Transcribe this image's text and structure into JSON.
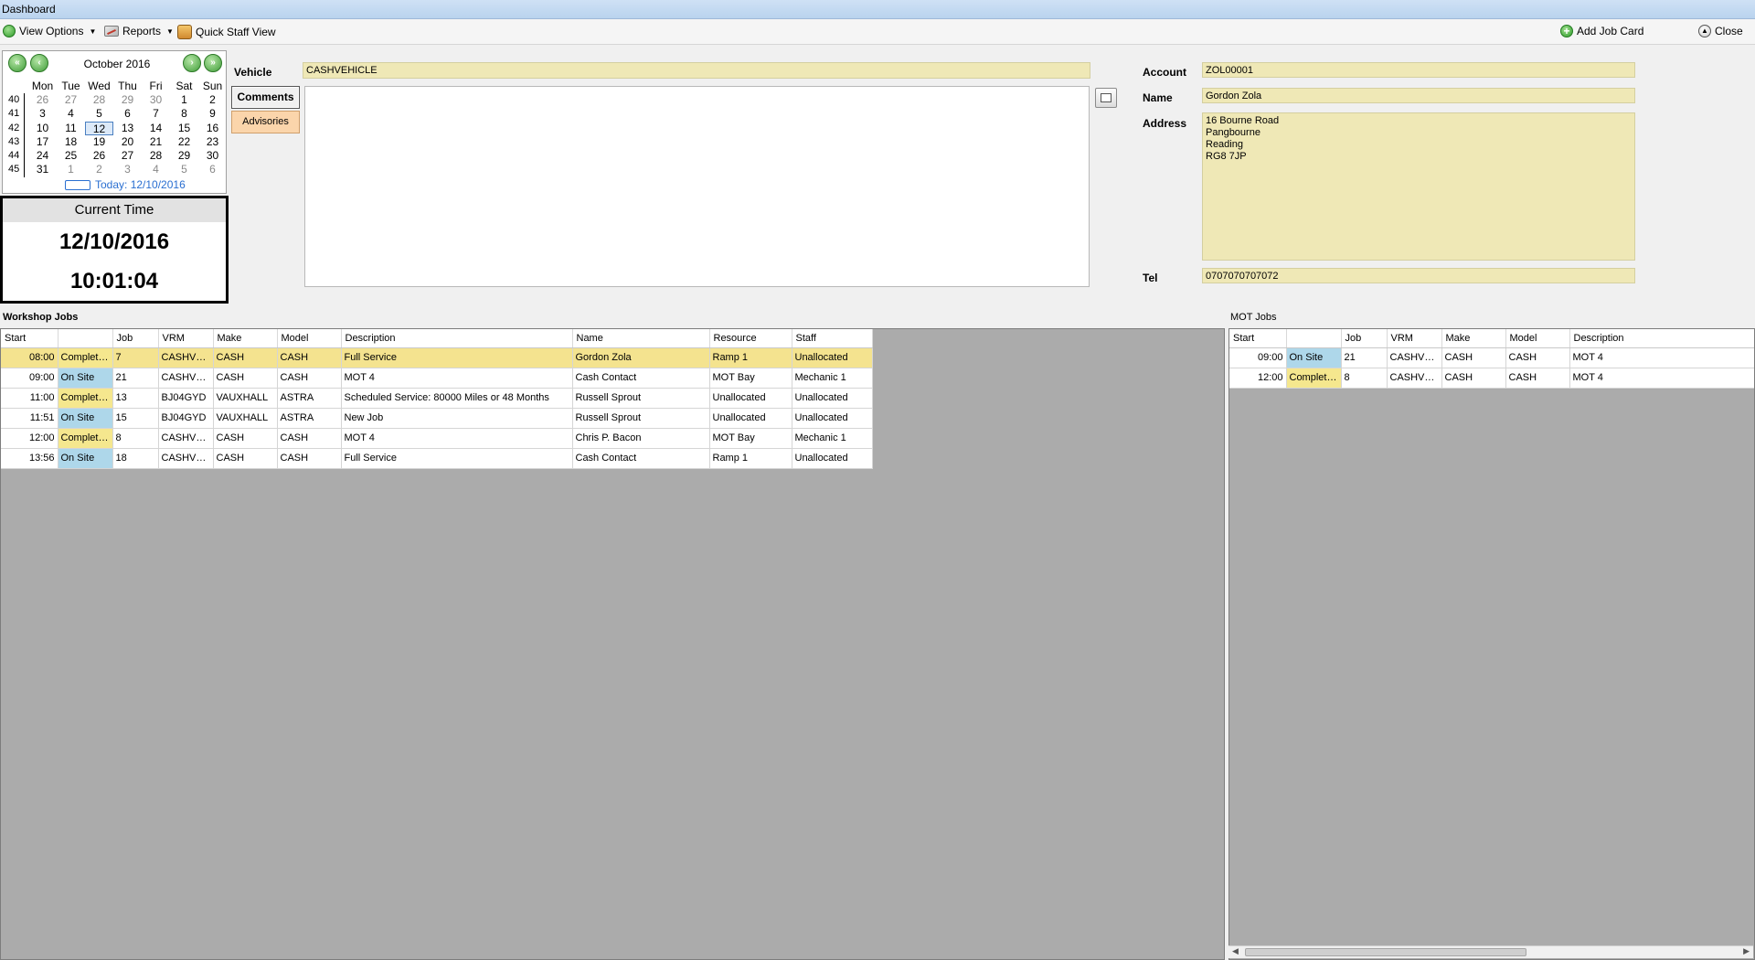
{
  "window": {
    "title": "Dashboard"
  },
  "toolbar": {
    "view_options": "View Options",
    "reports": "Reports",
    "quick_staff_view": "Quick Staff View",
    "add_job_card": "Add Job Card",
    "close": "Close"
  },
  "calendar": {
    "month_label": "October 2016",
    "day_headers": [
      "Mon",
      "Tue",
      "Wed",
      "Thu",
      "Fri",
      "Sat",
      "Sun"
    ],
    "week_numbers": [
      "40",
      "41",
      "42",
      "43",
      "44",
      "45"
    ],
    "days": [
      [
        "26",
        "27",
        "28",
        "29",
        "30",
        "1",
        "2"
      ],
      [
        "3",
        "4",
        "5",
        "6",
        "7",
        "8",
        "9"
      ],
      [
        "10",
        "11",
        "12",
        "13",
        "14",
        "15",
        "16"
      ],
      [
        "17",
        "18",
        "19",
        "20",
        "21",
        "22",
        "23"
      ],
      [
        "24",
        "25",
        "26",
        "27",
        "28",
        "29",
        "30"
      ],
      [
        "31",
        "1",
        "2",
        "3",
        "4",
        "5",
        "6"
      ]
    ],
    "selected_day": "12",
    "today_label": "Today: 12/10/2016"
  },
  "current_time": {
    "header": "Current Time",
    "date": "12/10/2016",
    "time": "10:01:04"
  },
  "job_detail": {
    "vehicle_label": "Vehicle",
    "vehicle_value": "CASHVEHICLE",
    "comments_tab": "Comments",
    "advisories_tab": "Advisories",
    "account_label": "Account",
    "account_value": "ZOL00001",
    "name_label": "Name",
    "name_value": "Gordon Zola",
    "address_label": "Address",
    "address_value": "16 Bourne Road\nPangbourne\nReading\nRG8 7JP",
    "tel_label": "Tel",
    "tel_value": "0707070707072"
  },
  "workshop_jobs": {
    "title": "Workshop Jobs",
    "columns": [
      "Start",
      "",
      "Job",
      "VRM",
      "Make",
      "Model",
      "Description",
      "Name",
      "Resource",
      "Staff"
    ],
    "rows": [
      {
        "start": "08:00",
        "status": "Completed",
        "job": "7",
        "vrm": "CASHVE...",
        "make": "CASH",
        "model": "CASH",
        "description": "Full Service",
        "name": "Gordon Zola",
        "resource": "Ramp 1",
        "staff": "Unallocated"
      },
      {
        "start": "09:00",
        "status": "On Site",
        "job": "21",
        "vrm": "CASHVE...",
        "make": "CASH",
        "model": "CASH",
        "description": "MOT 4",
        "name": "Cash Contact",
        "resource": "MOT Bay",
        "staff": "Mechanic 1"
      },
      {
        "start": "11:00",
        "status": "Completed",
        "job": "13",
        "vrm": "BJ04GYD",
        "make": "VAUXHALL",
        "model": "ASTRA",
        "description": "Scheduled Service: 80000 Miles or 48 Months",
        "name": "Russell Sprout",
        "resource": "Unallocated",
        "staff": "Unallocated"
      },
      {
        "start": "11:51",
        "status": "On Site",
        "job": "15",
        "vrm": "BJ04GYD",
        "make": "VAUXHALL",
        "model": "ASTRA",
        "description": "New Job",
        "name": "Russell Sprout",
        "resource": "Unallocated",
        "staff": "Unallocated"
      },
      {
        "start": "12:00",
        "status": "Completed",
        "job": "8",
        "vrm": "CASHVE...",
        "make": "CASH",
        "model": "CASH",
        "description": "MOT 4",
        "name": "Chris P. Bacon",
        "resource": "MOT Bay",
        "staff": "Mechanic 1"
      },
      {
        "start": "13:56",
        "status": "On Site",
        "job": "18",
        "vrm": "CASHVE...",
        "make": "CASH",
        "model": "CASH",
        "description": "Full Service",
        "name": "Cash Contact",
        "resource": "Ramp 1",
        "staff": "Unallocated"
      }
    ]
  },
  "mot_jobs": {
    "title": "MOT Jobs",
    "columns": [
      "Start",
      "",
      "Job",
      "VRM",
      "Make",
      "Model",
      "Description"
    ],
    "rows": [
      {
        "start": "09:00",
        "status": "On Site",
        "job": "21",
        "vrm": "CASHVE...",
        "make": "CASH",
        "model": "CASH",
        "description": "MOT 4"
      },
      {
        "start": "12:00",
        "status": "Completed",
        "job": "8",
        "vrm": "CASHVE...",
        "make": "CASH",
        "model": "CASH",
        "description": "MOT 4"
      }
    ]
  },
  "colors": {
    "field_bg": "#efe8b6",
    "completed": "#f5e78e",
    "on_site": "#aed7ea",
    "selected_row": "#f4e38f",
    "grid_empty": "#ababab"
  },
  "icons": {
    "view_options": "green-circle-arrow-icon",
    "reports": "chart-icon",
    "quick_staff_view": "staff-icon",
    "add_job_card": "green-plus-icon",
    "close": "eject-icon",
    "cal_prev_year": "double-left-arrow-icon",
    "cal_prev_month": "left-arrow-icon",
    "cal_next_month": "right-arrow-icon",
    "cal_next_year": "double-right-arrow-icon",
    "comments_edit": "notepad-icon"
  }
}
